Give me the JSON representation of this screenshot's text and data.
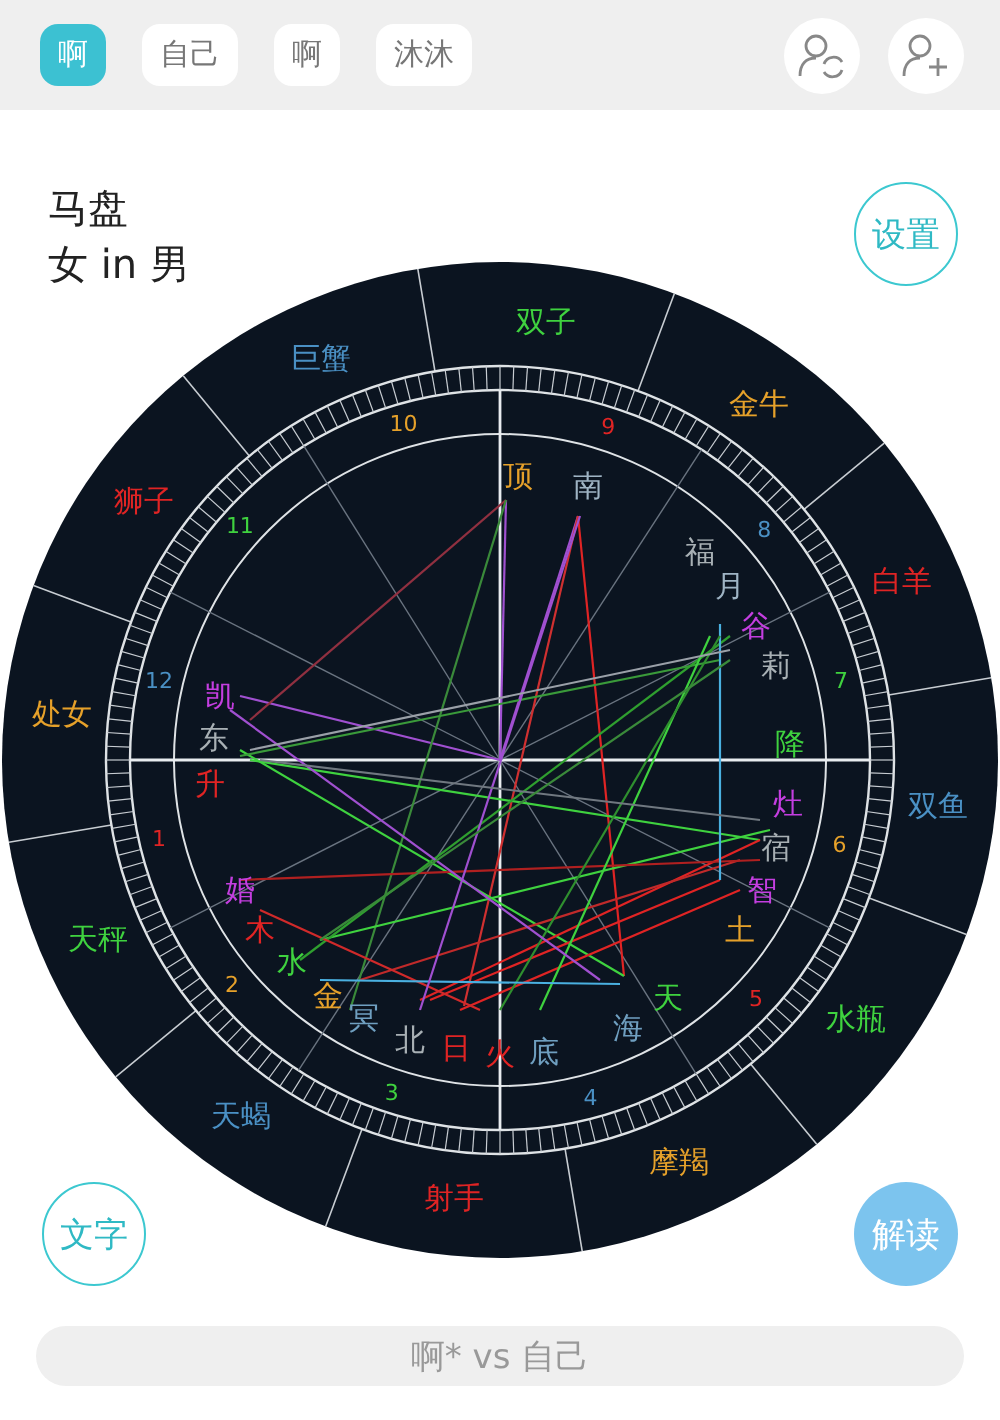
{
  "tabs": [
    {
      "label": "啊",
      "selected": true
    },
    {
      "label": "自己",
      "selected": false
    },
    {
      "label": "啊",
      "selected": false
    },
    {
      "label": "沐沐",
      "selected": false
    }
  ],
  "chart_title": "马盘",
  "chart_subtitle": "女 in 男",
  "settings_button": "设置",
  "text_button": "文字",
  "interpret_button": "解读",
  "zodiac_signs": [
    {
      "label": "白羊",
      "color": "#e02424"
    },
    {
      "label": "金牛",
      "color": "#e6a12a"
    },
    {
      "label": "双子",
      "color": "#3fd23f"
    },
    {
      "label": "巨蟹",
      "color": "#4a90c4"
    },
    {
      "label": "狮子",
      "color": "#e02424"
    },
    {
      "label": "处女",
      "color": "#e6a12a"
    },
    {
      "label": "天秤",
      "color": "#3fd23f"
    },
    {
      "label": "天蝎",
      "color": "#4a90c4"
    },
    {
      "label": "射手",
      "color": "#e02424"
    },
    {
      "label": "摩羯",
      "color": "#e6a12a"
    },
    {
      "label": "水瓶",
      "color": "#3fd23f"
    },
    {
      "label": "双鱼",
      "color": "#4a90c4"
    }
  ],
  "house_numbers": [
    {
      "label": "1",
      "color": "#e02424"
    },
    {
      "label": "2",
      "color": "#e6a12a"
    },
    {
      "label": "3",
      "color": "#3fd23f"
    },
    {
      "label": "4",
      "color": "#4a90c4"
    },
    {
      "label": "5",
      "color": "#e02424"
    },
    {
      "label": "6",
      "color": "#e6a12a"
    },
    {
      "label": "7",
      "color": "#3fd23f"
    },
    {
      "label": "8",
      "color": "#4a90c4"
    },
    {
      "label": "9",
      "color": "#e02424"
    },
    {
      "label": "10",
      "color": "#e6a12a"
    },
    {
      "label": "11",
      "color": "#3fd23f"
    },
    {
      "label": "12",
      "color": "#4a90c4"
    }
  ],
  "points": [
    {
      "label": "顶",
      "color": "#e6a12a"
    },
    {
      "label": "南",
      "color": "#9fb4c4"
    },
    {
      "label": "福",
      "color": "#a8b0b4"
    },
    {
      "label": "月",
      "color": "#9fb4c4"
    },
    {
      "label": "谷",
      "color": "#c43ee0"
    },
    {
      "label": "莉",
      "color": "#a8b0b4"
    },
    {
      "label": "降",
      "color": "#3fd23f"
    },
    {
      "label": "灶",
      "color": "#c43ee0"
    },
    {
      "label": "宿",
      "color": "#a8b0b4"
    },
    {
      "label": "智",
      "color": "#c43ee0"
    },
    {
      "label": "土",
      "color": "#e6a12a"
    },
    {
      "label": "凯",
      "color": "#c43ee0"
    },
    {
      "label": "东",
      "color": "#a8b0b4"
    },
    {
      "label": "升",
      "color": "#e02424"
    },
    {
      "label": "婚",
      "color": "#c43ee0"
    },
    {
      "label": "木",
      "color": "#e02424"
    },
    {
      "label": "水",
      "color": "#3fd23f"
    },
    {
      "label": "金",
      "color": "#e6a12a"
    },
    {
      "label": "冥",
      "color": "#6f9fc0"
    },
    {
      "label": "北",
      "color": "#a8b0b4"
    },
    {
      "label": "日",
      "color": "#e02424"
    },
    {
      "label": "火",
      "color": "#e02424"
    },
    {
      "label": "底",
      "color": "#6f9fc0"
    },
    {
      "label": "海",
      "color": "#6f9fc0"
    },
    {
      "label": "天",
      "color": "#3fd23f"
    }
  ],
  "footer": "啊* vs 自己"
}
